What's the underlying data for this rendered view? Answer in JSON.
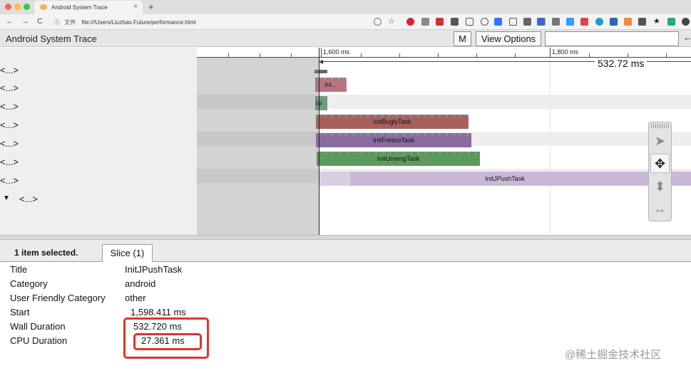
{
  "browser": {
    "tab_title": "Android System Trace",
    "tab_close": "×",
    "new_tab": "+",
    "url_label": "文件",
    "url": "file:///Users/Liuzhao.Future/performance.html",
    "back": "←",
    "forward": "→",
    "reload": "C",
    "info": "ⓘ"
  },
  "trace_header": {
    "title": "Android System Trace",
    "m_button": "M",
    "view_options": "View Options",
    "back_arrow": "←"
  },
  "tracks": [
    {
      "label": "<...>"
    },
    {
      "label": "<...>"
    },
    {
      "label": "<...>"
    },
    {
      "label": "<...>"
    },
    {
      "label": "<...>"
    },
    {
      "label": "<...>"
    },
    {
      "label": "<...>"
    },
    {
      "label": "<...>",
      "expander": "▼"
    }
  ],
  "ruler": {
    "label_1600": "1,600 ms",
    "label_1800": "1,800 ms"
  },
  "measurement": "532.72 ms",
  "slices": [
    {
      "name": "Ini...",
      "color": "#b97480"
    },
    {
      "name": "Ini",
      "color": "#6f9a80"
    },
    {
      "name": "InitBuglyTask",
      "color": "#a9605c"
    },
    {
      "name": "InitFrescoTask",
      "color": "#8a6ca0"
    },
    {
      "name": "InitUmengTask",
      "color": "#5c9a5c"
    },
    {
      "name": "InitJPushTask",
      "color": "#c9b9d6"
    }
  ],
  "tools": {
    "select": "➤",
    "pan": "✥",
    "zoom": "⬍",
    "timing": "↔"
  },
  "selection": {
    "count_text": "1 item selected.",
    "tab_label": "Slice (1)"
  },
  "details": [
    {
      "key": "Title",
      "value": "InitJPushTask"
    },
    {
      "key": "Category",
      "value": "android"
    },
    {
      "key": "User Friendly Category",
      "value": "other"
    },
    {
      "key": "Start",
      "value": "1,598.411 ms"
    },
    {
      "key": "Wall Duration",
      "value": "532.720 ms"
    },
    {
      "key": "CPU Duration",
      "value": "27.361 ms"
    }
  ],
  "watermark": "@稀土掘金技术社区",
  "colors": {
    "highlight": "#e43328"
  }
}
